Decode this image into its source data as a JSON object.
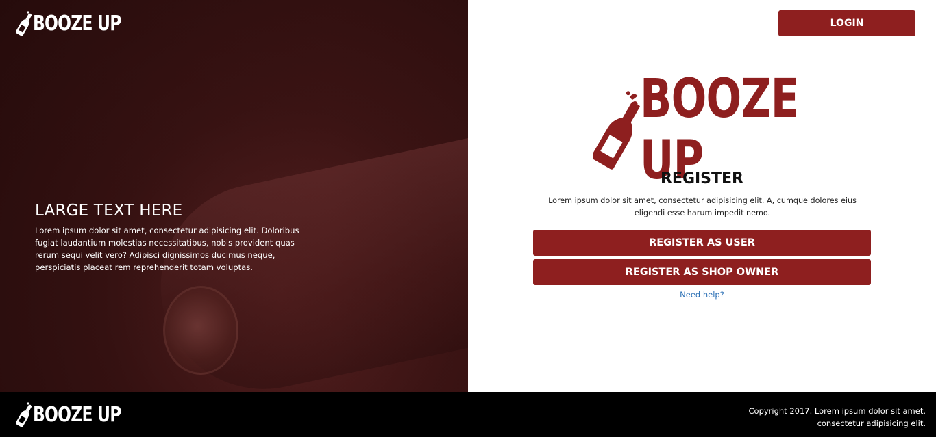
{
  "brand": {
    "name": "BOOZE UP",
    "icon": "bottle-icon",
    "accent_color": "#8e1f1f"
  },
  "header": {
    "login_label": "LOGIN"
  },
  "hero": {
    "title": "LARGE TEXT HERE",
    "body": "Lorem ipsum dolor sit amet, consectetur adipisicing elit. Doloribus fugiat laudantium molestias necessitatibus, nobis provident quas rerum sequi velit vero? Adipisci dignissimos ducimus neque, perspiciatis placeat rem reprehenderit totam voluptas."
  },
  "register": {
    "title": "REGISTER",
    "description": "Lorem ipsum dolor sit amet, consectetur adipisicing elit. A, cumque dolores eius eligendi esse harum impedit nemo.",
    "user_button": "REGISTER AS USER",
    "owner_button": "REGISTER AS SHOP OWNER",
    "help_link": "Need help?"
  },
  "footer": {
    "copyright_line1": "Copyright 2017. Lorem ipsum dolor sit amet.",
    "copyright_line2": "consectetur adipisicing elit."
  }
}
